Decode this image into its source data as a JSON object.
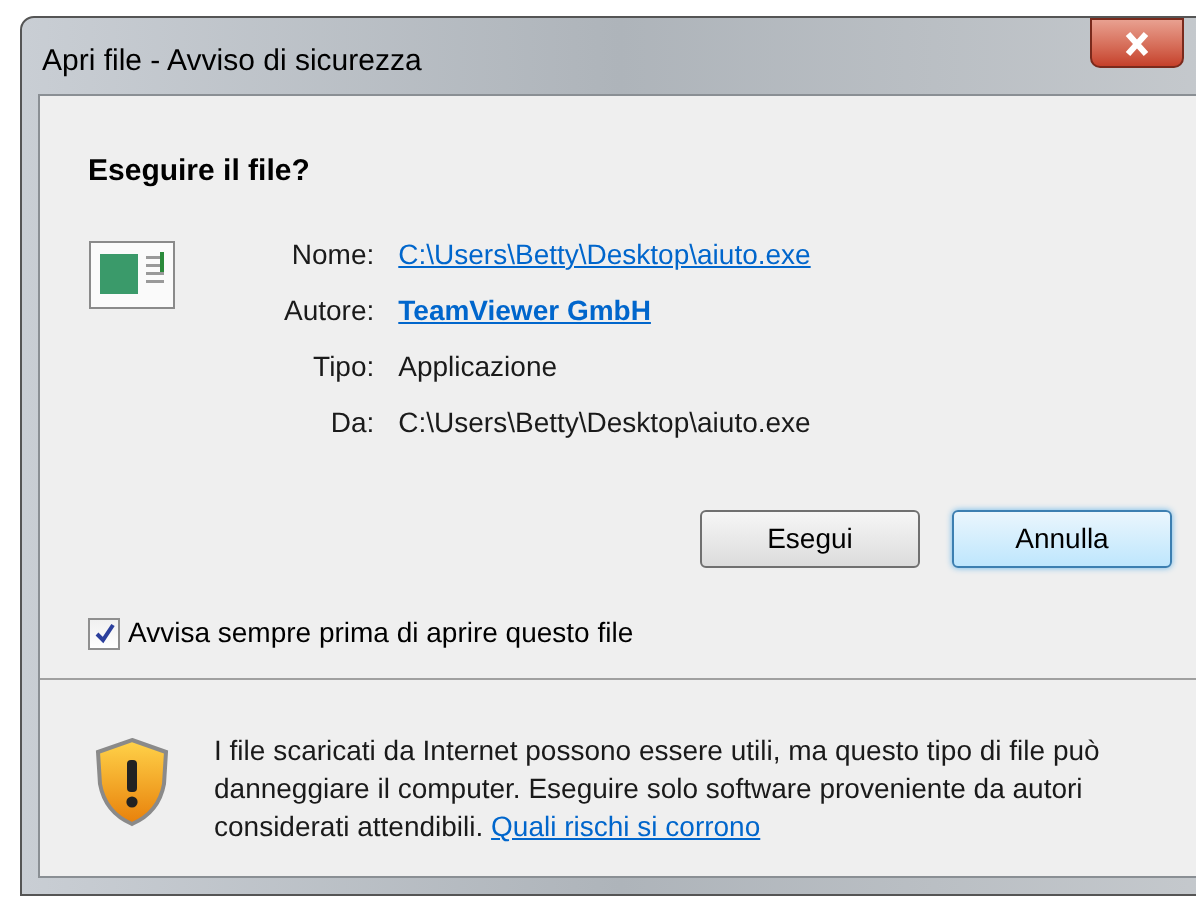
{
  "window": {
    "title": "Apri file - Avviso di sicurezza"
  },
  "heading": "Eseguire il file?",
  "details": [
    {
      "label": "Nome:",
      "value": "C:\\Users\\Betty\\Desktop\\aiuto.exe",
      "kind": "link"
    },
    {
      "label": "Autore:",
      "value": "TeamViewer GmbH",
      "kind": "bold_link"
    },
    {
      "label": "Tipo:",
      "value": "Applicazione",
      "kind": "text"
    },
    {
      "label": "Da:",
      "value": "C:\\Users\\Betty\\Desktop\\aiuto.exe",
      "kind": "text"
    }
  ],
  "buttons": [
    {
      "label": "Esegui",
      "focused": false
    },
    {
      "label": "Annulla",
      "focused": true
    }
  ],
  "checkbox": {
    "label": "Avvisa sempre prima di aprire questo file",
    "checked": true
  },
  "footer": {
    "text": "I file scaricati da Internet possono essere utili, ma questo tipo di file può danneggiare il computer. Eseguire solo software proveniente da autori considerati attendibili.",
    "link": "Quali rischi si corrono"
  }
}
